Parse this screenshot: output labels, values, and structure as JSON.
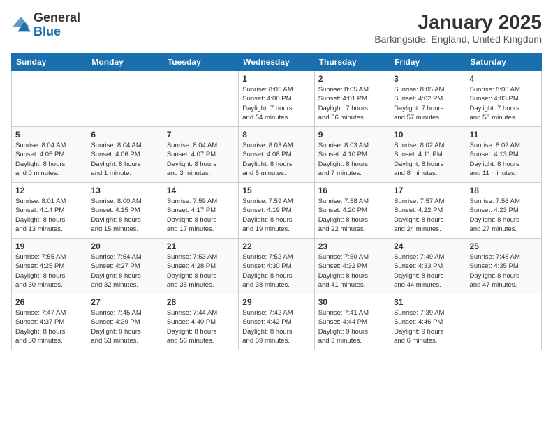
{
  "header": {
    "logo": {
      "line1": "General",
      "line2": "Blue"
    },
    "title": "January 2025",
    "location": "Barkingside, England, United Kingdom"
  },
  "calendar": {
    "weekdays": [
      "Sunday",
      "Monday",
      "Tuesday",
      "Wednesday",
      "Thursday",
      "Friday",
      "Saturday"
    ],
    "weeks": [
      [
        {
          "day": "",
          "info": ""
        },
        {
          "day": "",
          "info": ""
        },
        {
          "day": "",
          "info": ""
        },
        {
          "day": "1",
          "info": "Sunrise: 8:05 AM\nSunset: 4:00 PM\nDaylight: 7 hours\nand 54 minutes."
        },
        {
          "day": "2",
          "info": "Sunrise: 8:05 AM\nSunset: 4:01 PM\nDaylight: 7 hours\nand 56 minutes."
        },
        {
          "day": "3",
          "info": "Sunrise: 8:05 AM\nSunset: 4:02 PM\nDaylight: 7 hours\nand 57 minutes."
        },
        {
          "day": "4",
          "info": "Sunrise: 8:05 AM\nSunset: 4:03 PM\nDaylight: 7 hours\nand 58 minutes."
        }
      ],
      [
        {
          "day": "5",
          "info": "Sunrise: 8:04 AM\nSunset: 4:05 PM\nDaylight: 8 hours\nand 0 minutes."
        },
        {
          "day": "6",
          "info": "Sunrise: 8:04 AM\nSunset: 4:06 PM\nDaylight: 8 hours\nand 1 minute."
        },
        {
          "day": "7",
          "info": "Sunrise: 8:04 AM\nSunset: 4:07 PM\nDaylight: 8 hours\nand 3 minutes."
        },
        {
          "day": "8",
          "info": "Sunrise: 8:03 AM\nSunset: 4:08 PM\nDaylight: 8 hours\nand 5 minutes."
        },
        {
          "day": "9",
          "info": "Sunrise: 8:03 AM\nSunset: 4:10 PM\nDaylight: 8 hours\nand 7 minutes."
        },
        {
          "day": "10",
          "info": "Sunrise: 8:02 AM\nSunset: 4:11 PM\nDaylight: 8 hours\nand 8 minutes."
        },
        {
          "day": "11",
          "info": "Sunrise: 8:02 AM\nSunset: 4:13 PM\nDaylight: 8 hours\nand 11 minutes."
        }
      ],
      [
        {
          "day": "12",
          "info": "Sunrise: 8:01 AM\nSunset: 4:14 PM\nDaylight: 8 hours\nand 13 minutes."
        },
        {
          "day": "13",
          "info": "Sunrise: 8:00 AM\nSunset: 4:15 PM\nDaylight: 8 hours\nand 15 minutes."
        },
        {
          "day": "14",
          "info": "Sunrise: 7:59 AM\nSunset: 4:17 PM\nDaylight: 8 hours\nand 17 minutes."
        },
        {
          "day": "15",
          "info": "Sunrise: 7:59 AM\nSunset: 4:19 PM\nDaylight: 8 hours\nand 19 minutes."
        },
        {
          "day": "16",
          "info": "Sunrise: 7:58 AM\nSunset: 4:20 PM\nDaylight: 8 hours\nand 22 minutes."
        },
        {
          "day": "17",
          "info": "Sunrise: 7:57 AM\nSunset: 4:22 PM\nDaylight: 8 hours\nand 24 minutes."
        },
        {
          "day": "18",
          "info": "Sunrise: 7:56 AM\nSunset: 4:23 PM\nDaylight: 8 hours\nand 27 minutes."
        }
      ],
      [
        {
          "day": "19",
          "info": "Sunrise: 7:55 AM\nSunset: 4:25 PM\nDaylight: 8 hours\nand 30 minutes."
        },
        {
          "day": "20",
          "info": "Sunrise: 7:54 AM\nSunset: 4:27 PM\nDaylight: 8 hours\nand 32 minutes."
        },
        {
          "day": "21",
          "info": "Sunrise: 7:53 AM\nSunset: 4:28 PM\nDaylight: 8 hours\nand 35 minutes."
        },
        {
          "day": "22",
          "info": "Sunrise: 7:52 AM\nSunset: 4:30 PM\nDaylight: 8 hours\nand 38 minutes."
        },
        {
          "day": "23",
          "info": "Sunrise: 7:50 AM\nSunset: 4:32 PM\nDaylight: 8 hours\nand 41 minutes."
        },
        {
          "day": "24",
          "info": "Sunrise: 7:49 AM\nSunset: 4:33 PM\nDaylight: 8 hours\nand 44 minutes."
        },
        {
          "day": "25",
          "info": "Sunrise: 7:48 AM\nSunset: 4:35 PM\nDaylight: 8 hours\nand 47 minutes."
        }
      ],
      [
        {
          "day": "26",
          "info": "Sunrise: 7:47 AM\nSunset: 4:37 PM\nDaylight: 8 hours\nand 50 minutes."
        },
        {
          "day": "27",
          "info": "Sunrise: 7:45 AM\nSunset: 4:39 PM\nDaylight: 8 hours\nand 53 minutes."
        },
        {
          "day": "28",
          "info": "Sunrise: 7:44 AM\nSunset: 4:40 PM\nDaylight: 8 hours\nand 56 minutes."
        },
        {
          "day": "29",
          "info": "Sunrise: 7:42 AM\nSunset: 4:42 PM\nDaylight: 8 hours\nand 59 minutes."
        },
        {
          "day": "30",
          "info": "Sunrise: 7:41 AM\nSunset: 4:44 PM\nDaylight: 9 hours\nand 3 minutes."
        },
        {
          "day": "31",
          "info": "Sunrise: 7:39 AM\nSunset: 4:46 PM\nDaylight: 9 hours\nand 6 minutes."
        },
        {
          "day": "",
          "info": ""
        }
      ]
    ]
  }
}
